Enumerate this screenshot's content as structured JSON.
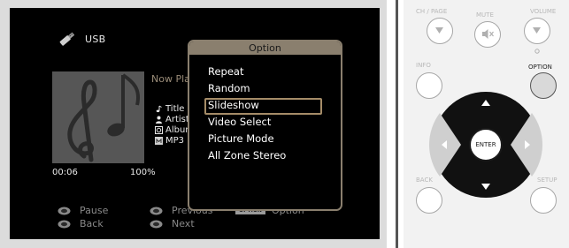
{
  "screen": {
    "source_label": "USB",
    "now_playing": "Now Pla",
    "meta": {
      "title": "Title",
      "artist": "Artist",
      "album": "Albur",
      "format": "MP3 1"
    },
    "time_elapsed": "00:06",
    "zoom_level": "100%",
    "hints": {
      "pause": "Pause",
      "back": "Back",
      "previous": "Previous",
      "next": "Next",
      "option_badge": "OPTION",
      "option": "Option"
    },
    "option_popup": {
      "title": "Option",
      "items": [
        "Repeat",
        "Random",
        "Slideshow",
        "Video Select",
        "Picture Mode",
        "All Zone Stereo"
      ],
      "selected": "Slideshow"
    }
  },
  "remote": {
    "labels": {
      "ch_page": "CH / PAGE",
      "mute": "MUTE",
      "volume": "VOLUME",
      "info": "INFO",
      "option": "OPTION",
      "enter": "ENTER",
      "back": "BACK",
      "setup": "SETUP"
    }
  },
  "colors": {
    "popup_border": "#8a7f6e",
    "selection": "#a58c68",
    "screen_bg": "#000000",
    "remote_bg": "#f2f2f2"
  }
}
